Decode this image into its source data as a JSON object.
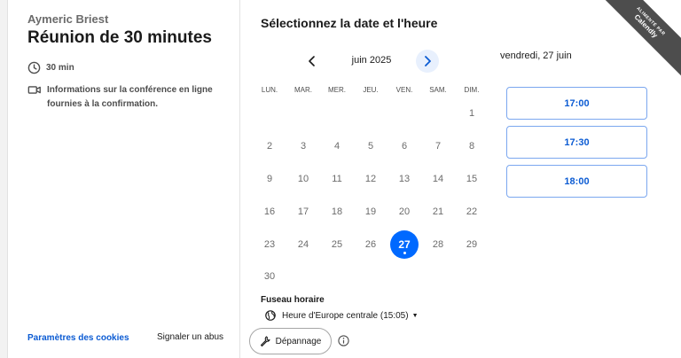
{
  "event": {
    "host": "Aymeric Briest",
    "title": "Réunion de 30 minutes",
    "duration": "30 min",
    "conference_info": "Informations sur la conférence en ligne fournies à la confirmation."
  },
  "footer": {
    "cookies_link": "Paramètres des cookies",
    "report_abuse": "Signaler un abus"
  },
  "calendar": {
    "heading": "Sélectionnez la date et l'heure",
    "month": "juin 2025",
    "weekdays": [
      "LUN.",
      "MAR.",
      "MER.",
      "JEU.",
      "VEN.",
      "SAM.",
      "DIM."
    ],
    "days": [
      "",
      "",
      "",
      "",
      "",
      "",
      "1",
      "2",
      "3",
      "4",
      "5",
      "6",
      "7",
      "8",
      "9",
      "10",
      "11",
      "12",
      "13",
      "14",
      "15",
      "16",
      "17",
      "18",
      "19",
      "20",
      "21",
      "22",
      "23",
      "24",
      "25",
      "26",
      "27",
      "28",
      "29",
      "30"
    ],
    "selected_day": "27"
  },
  "timezone": {
    "label": "Fuseau horaire",
    "value": "Heure d'Europe centrale (15:05)"
  },
  "troubleshoot_label": "Dépannage",
  "selected_date": "vendredi, 27 juin",
  "time_slots": [
    "17:00",
    "17:30",
    "18:00"
  ],
  "ribbon": {
    "line1": "ALIMENTÉ PAR",
    "line2": "Calendly"
  },
  "colors": {
    "accent": "#0069ff",
    "link": "#0b5bd3",
    "ribbon": "#4d4d4d"
  }
}
